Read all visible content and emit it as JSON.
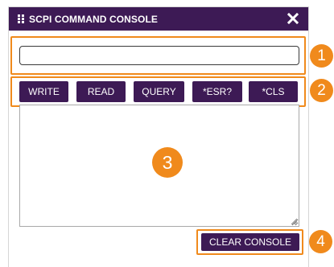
{
  "window": {
    "title": "SCPI COMMAND CONSOLE",
    "close_icon": "close-icon"
  },
  "command_input": {
    "value": "",
    "placeholder": ""
  },
  "buttons": {
    "write": "WRITE",
    "read": "READ",
    "query": "QUERY",
    "esr": "*ESR?",
    "cls": "*CLS",
    "clear_console": "CLEAR CONSOLE"
  },
  "console_output": {
    "value": ""
  },
  "callouts": [
    "1",
    "2",
    "3",
    "4"
  ],
  "colors": {
    "primary": "#3d1a55",
    "callout": "#f08a1c",
    "background": "#ffffff"
  }
}
